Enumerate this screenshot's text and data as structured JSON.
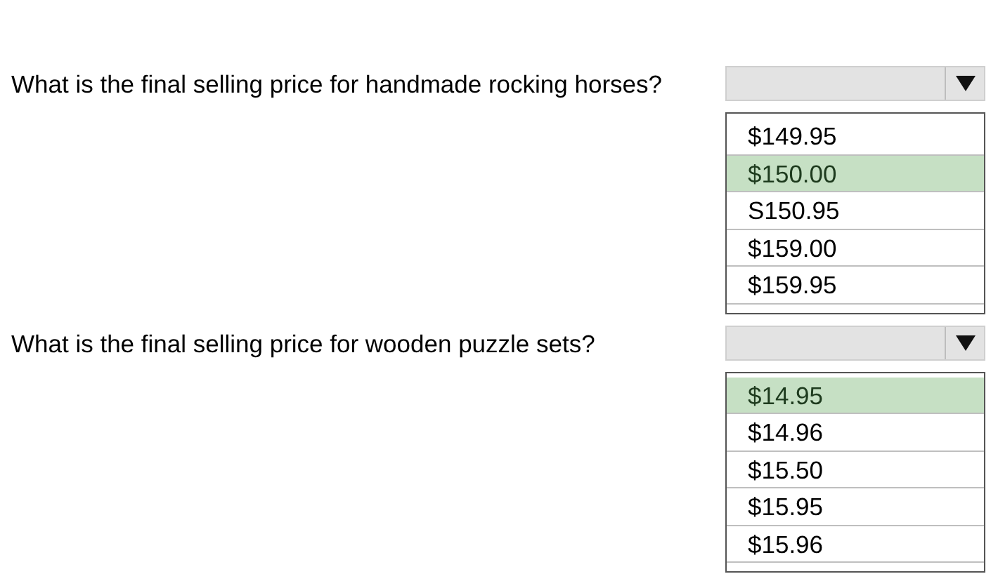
{
  "questions": [
    {
      "text": "What is the final selling price for handmade rocking horses?",
      "options": [
        {
          "label": "$149.95",
          "selected": false
        },
        {
          "label": "$150.00",
          "selected": true
        },
        {
          "label": "S150.95",
          "selected": false
        },
        {
          "label": "$159.00",
          "selected": false
        },
        {
          "label": "$159.95",
          "selected": false
        }
      ]
    },
    {
      "text": "What is the final selling price for wooden puzzle sets?",
      "options": [
        {
          "label": "$14.95",
          "selected": true
        },
        {
          "label": "$14.96",
          "selected": false
        },
        {
          "label": "$15.50",
          "selected": false
        },
        {
          "label": "$15.95",
          "selected": false
        },
        {
          "label": "$15.96",
          "selected": false
        }
      ]
    }
  ]
}
